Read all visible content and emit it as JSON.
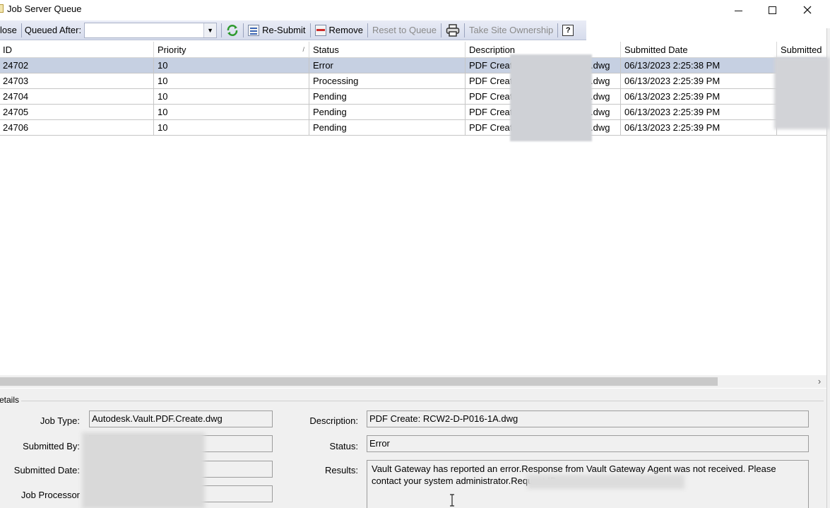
{
  "window": {
    "title": "Job Server Queue",
    "minimize_glyph": "—",
    "maximize_glyph": "☐",
    "close_glyph": "✕"
  },
  "toolbar": {
    "close_label": "lose",
    "queued_after_label": "Queued After:",
    "queued_after_value": "",
    "resubmit_label": "Re-Submit",
    "remove_label": "Remove",
    "reset_label": "Reset to Queue",
    "take_ownership_label": "Take Site Ownership",
    "help_glyph": "?"
  },
  "grid": {
    "columns": [
      "ID",
      "Priority",
      "Status",
      "Description",
      "Submitted Date",
      "Submitted"
    ],
    "rows": [
      {
        "id": "24702",
        "priority": "10",
        "status": "Error",
        "desc_prefix": "PDF Create",
        "desc_suffix": ".dwg",
        "date": "06/13/2023 2:25:38 PM"
      },
      {
        "id": "24703",
        "priority": "10",
        "status": "Processing",
        "desc_prefix": "PDF Create",
        "desc_suffix": ".dwg",
        "date": "06/13/2023 2:25:39 PM"
      },
      {
        "id": "24704",
        "priority": "10",
        "status": "Pending",
        "desc_prefix": "PDF Create",
        "desc_suffix": ".dwg",
        "date": "06/13/2023 2:25:39 PM"
      },
      {
        "id": "24705",
        "priority": "10",
        "status": "Pending",
        "desc_prefix": "PDF Create",
        "desc_suffix": ".dwg",
        "date": "06/13/2023 2:25:39 PM"
      },
      {
        "id": "24706",
        "priority": "10",
        "status": "Pending",
        "desc_prefix": "PDF Create",
        "desc_suffix": ".dwg",
        "date": "06/13/2023 2:25:39 PM"
      }
    ],
    "selected_row": 0,
    "scroll_right_glyph": "›"
  },
  "details": {
    "group_label": "etails",
    "job_type_label": "Job Type:",
    "job_type_value": "Autodesk.Vault.PDF.Create.dwg",
    "submitted_by_label": "Submitted By:",
    "submitted_date_label": "Submitted Date:",
    "job_processor_label": "Job Processor",
    "description_label": "Description:",
    "description_value": "PDF Create: RCW2-D-P016-1A.dwg",
    "status_label": "Status:",
    "status_value": "Error",
    "results_label": "Results:",
    "results_value": "Vault Gateway has reported an error.Response from Vault Gateway Agent was not received. Please contact your system administrator.Request ID:"
  },
  "colors": {
    "selected_row": "#c6d0e2",
    "toolbar_top": "#e9ecf6",
    "toolbar_bottom": "#d6dcec",
    "panel_bg": "#f0f0f0"
  }
}
